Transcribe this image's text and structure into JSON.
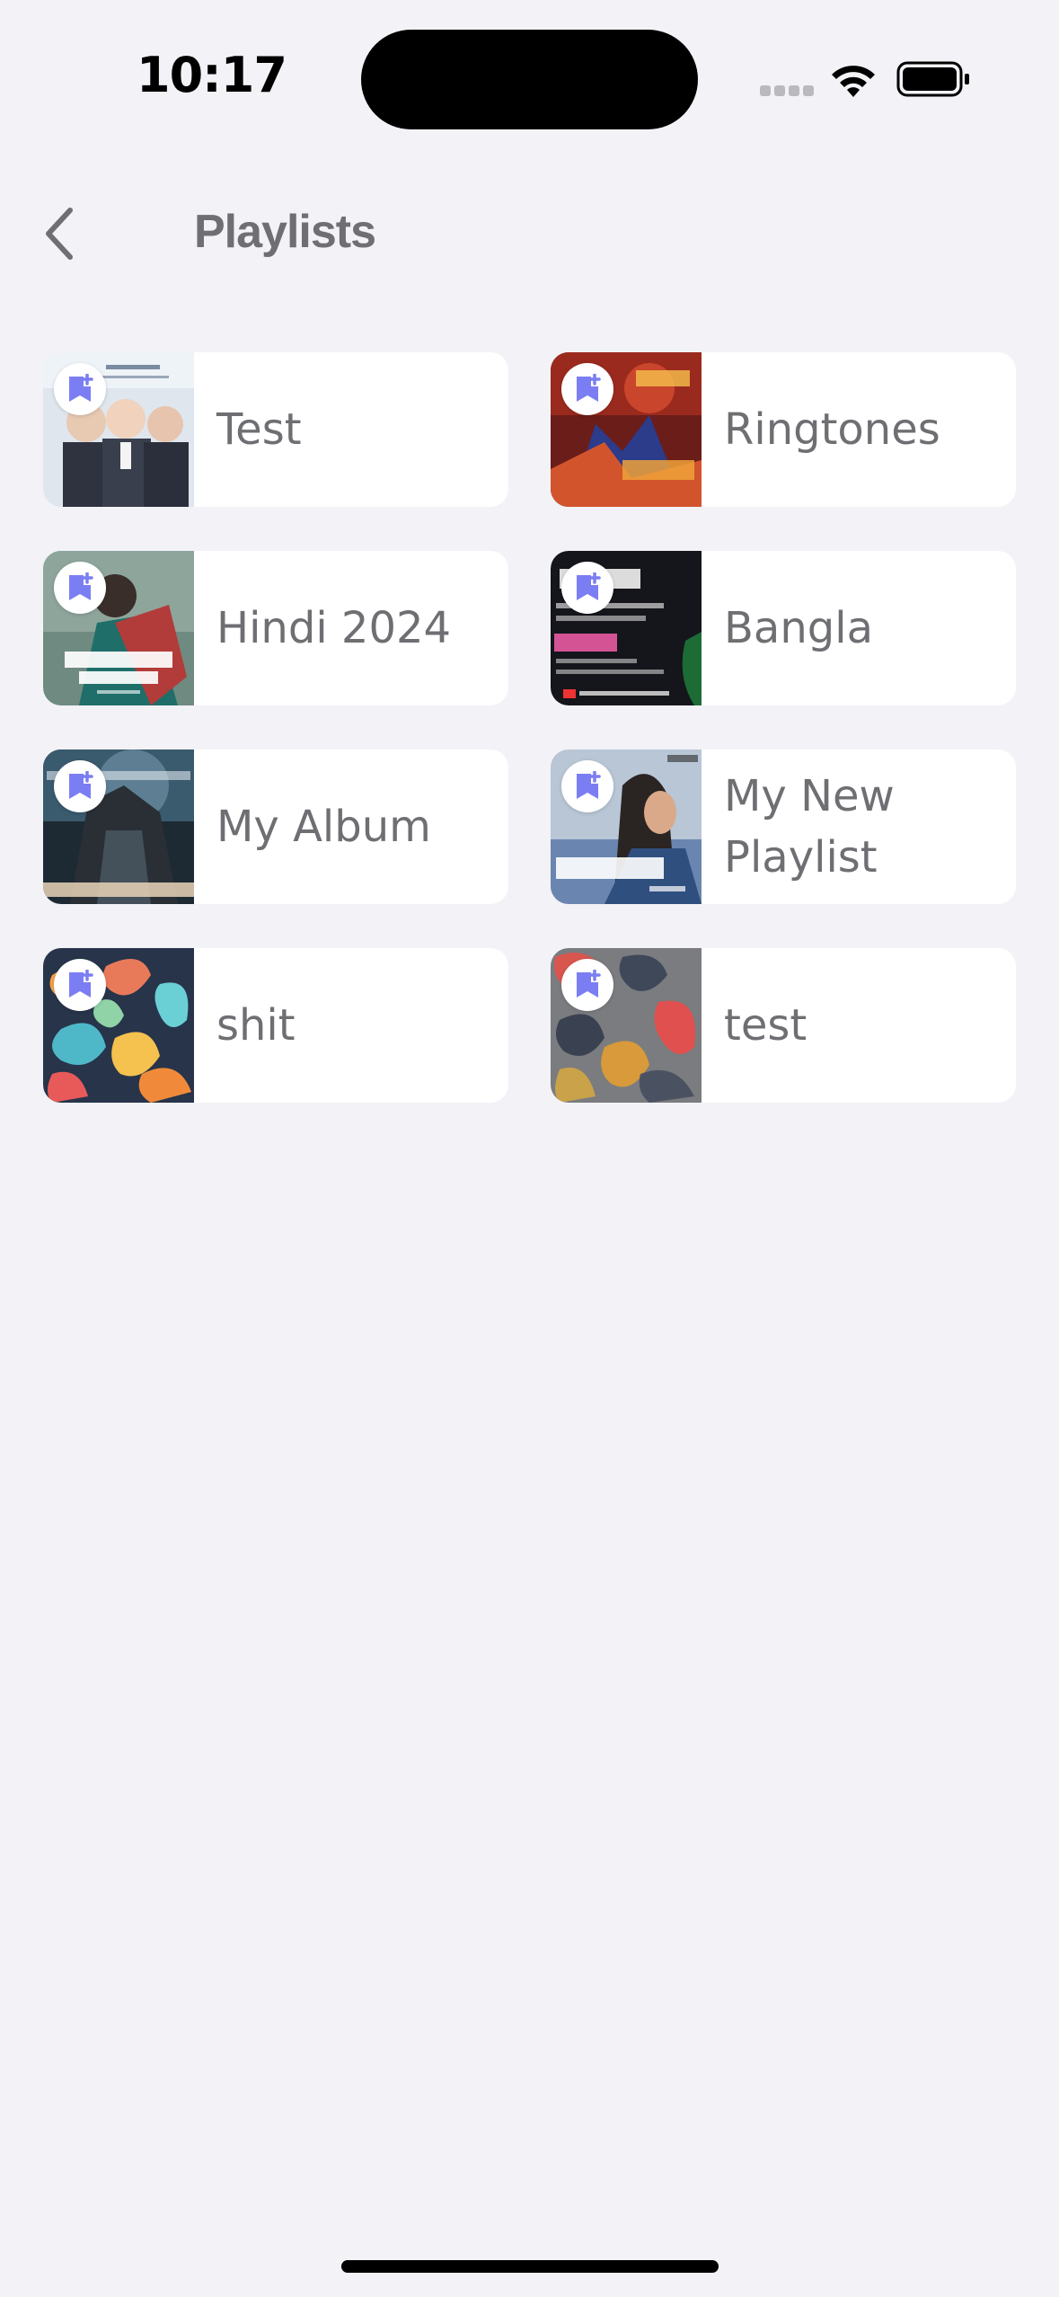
{
  "status_bar": {
    "time": "10:17"
  },
  "nav": {
    "title": "Playlists",
    "back_icon": "chevron-left-icon"
  },
  "theme": {
    "background": "#f2f2f7",
    "accent": "#7b7ef2",
    "label_color": "#6e6e73"
  },
  "playlists": [
    {
      "name": "Test",
      "art": "school-photo",
      "badge_icon": "bookmark-plus-icon"
    },
    {
      "name": "Ringtones",
      "art": "red-poster",
      "badge_icon": "bookmark-plus-icon"
    },
    {
      "name": "Hindi 2024",
      "art": "teal-poster",
      "badge_icon": "bookmark-plus-icon"
    },
    {
      "name": "Bangla",
      "art": "dark-poster",
      "badge_icon": "bookmark-plus-icon"
    },
    {
      "name": "My Album",
      "art": "scifi-poster",
      "badge_icon": "bookmark-plus-icon"
    },
    {
      "name": "My New Playlist",
      "art": "blue-portrait",
      "badge_icon": "bookmark-plus-icon"
    },
    {
      "name": "shit",
      "art": "colorful-blobs",
      "badge_icon": "bookmark-plus-icon"
    },
    {
      "name": "test",
      "art": "grey-blobs",
      "badge_icon": "bookmark-plus-icon"
    }
  ]
}
